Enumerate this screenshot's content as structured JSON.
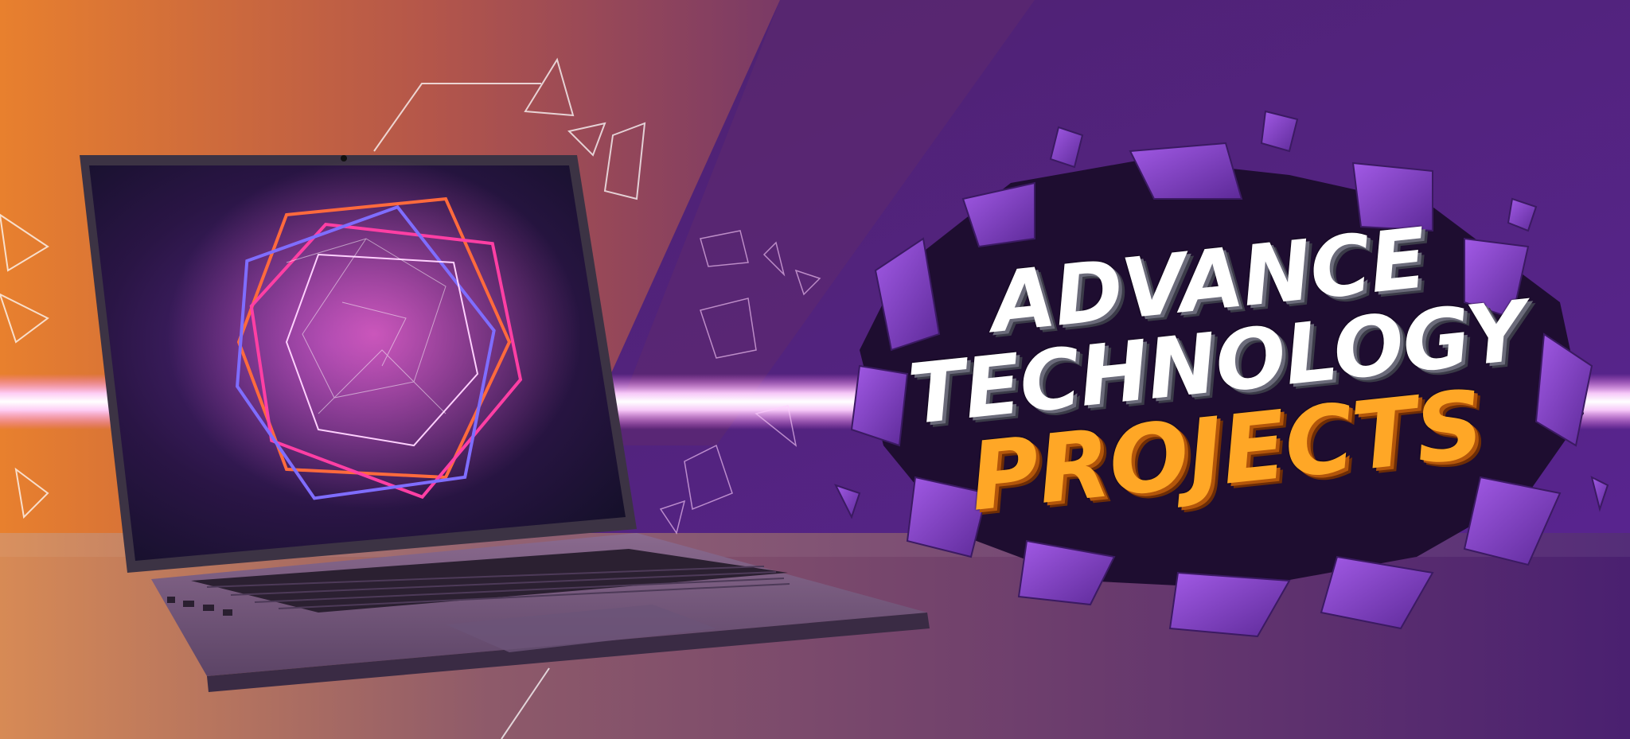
{
  "banner": {
    "headline": {
      "line1": "ADVANCE",
      "line2": "TECHNOLOGY",
      "line3": "PROJECTS"
    }
  },
  "colors": {
    "bg_orange": "#e2782f",
    "bg_purple": "#4a1f7a",
    "crystal_purple": "#8b3fd0",
    "title_white": "#ffffff",
    "title_orange": "#ffa726",
    "light_streak": "#ffe6ff"
  },
  "icons": [
    "laptop-icon",
    "neon-polygon-icon",
    "crystal-shard-icon"
  ]
}
